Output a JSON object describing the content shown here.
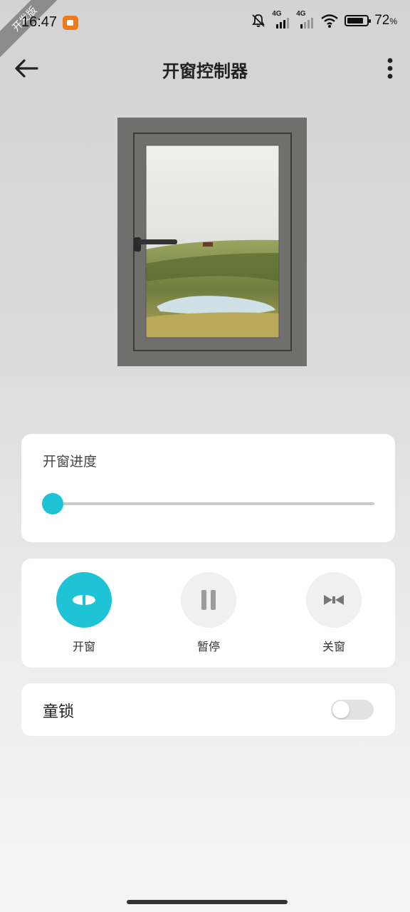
{
  "status_bar": {
    "time": "16:47",
    "corner_ribbon": "开发版",
    "network_1": "4G",
    "network_2": "4G",
    "battery_percent": "72",
    "battery_unit": "%"
  },
  "app_bar": {
    "title": "开窗控制器",
    "back_icon": "arrow-left-icon",
    "more_icon": "more-vertical-icon"
  },
  "progress": {
    "label": "开窗进度",
    "value_percent": 0,
    "accent_color": "#1ec3d6"
  },
  "controls": {
    "open_label": "开窗",
    "pause_label": "暂停",
    "close_label": "关窗",
    "active": "open"
  },
  "child_lock": {
    "label": "童锁",
    "enabled": false
  }
}
